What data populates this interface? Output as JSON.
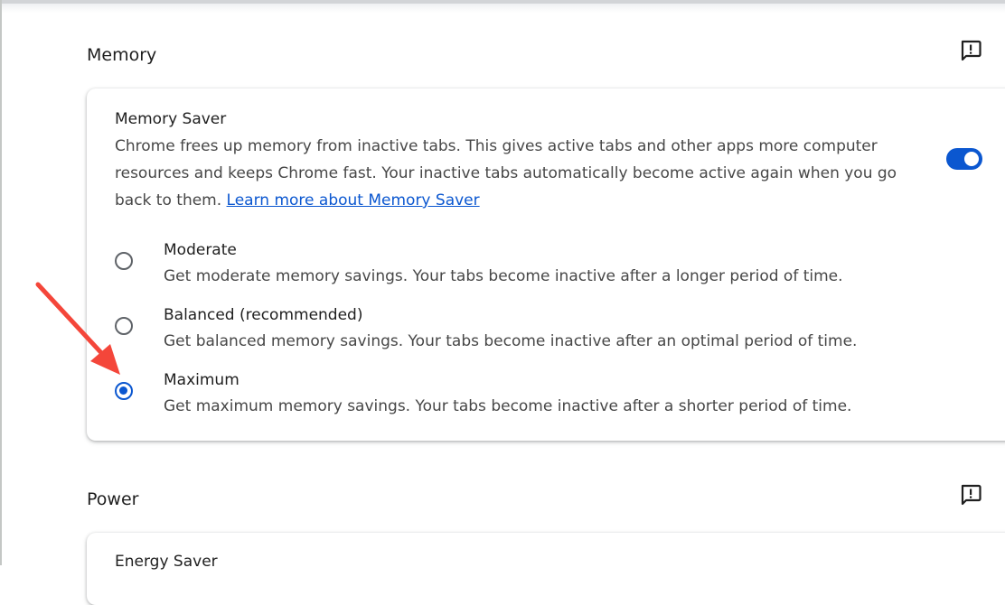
{
  "memory": {
    "section_title": "Memory",
    "memory_saver": {
      "title": "Memory Saver",
      "description": "Chrome frees up memory from inactive tabs. This gives active tabs and other apps more computer resources and keeps Chrome fast. Your inactive tabs automatically become active again when you go back to them.",
      "learn_more": "Learn more about Memory Saver",
      "enabled": true
    },
    "options": [
      {
        "label": "Moderate",
        "description": "Get moderate memory savings. Your tabs become inactive after a longer period of time.",
        "selected": false
      },
      {
        "label": "Balanced (recommended)",
        "description": "Get balanced memory savings. Your tabs become inactive after an optimal period of time.",
        "selected": false
      },
      {
        "label": "Maximum",
        "description": "Get maximum memory savings. Your tabs become inactive after a shorter period of time.",
        "selected": true
      }
    ]
  },
  "power": {
    "section_title": "Power",
    "energy_saver": {
      "title": "Energy Saver"
    }
  },
  "icons": {
    "feedback": "feedback-icon",
    "annotation_arrow": "arrow-icon"
  },
  "colors": {
    "accent": "#0b57d0",
    "annotation": "#f4463a"
  }
}
